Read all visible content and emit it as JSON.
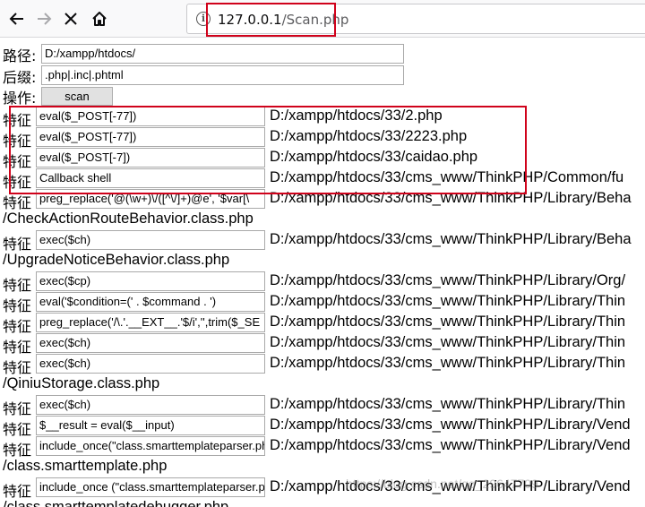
{
  "browser": {
    "back_icon": "arrow-left-icon",
    "forward_icon": "arrow-right-icon",
    "stop_icon": "close-icon",
    "home_icon": "home-icon",
    "info_icon": "info-icon",
    "url_host": "127.0.0.1",
    "url_path": "/Scan.php",
    "highlight_color": "#d0021b"
  },
  "form": {
    "path_label": "路径:",
    "path_value": "D:/xampp/htdocs/",
    "suffix_label": "后缀:",
    "suffix_value": ".php|.inc|.phtml",
    "action_label": "操作:",
    "scan_button": "scan"
  },
  "results": [
    {
      "label": "特征",
      "feature": "eval($_POST[-77])",
      "path": "D:/xampp/htdocs/33/2.php"
    },
    {
      "label": "特征",
      "feature": "eval($_POST[-77])",
      "path": "D:/xampp/htdocs/33/2223.php"
    },
    {
      "label": "特征",
      "feature": "eval($_POST[-7])",
      "path": "D:/xampp/htdocs/33/caidao.php"
    },
    {
      "label": "特征",
      "feature": "Callback shell",
      "path": "D:/xampp/htdocs/33/cms_www/ThinkPHP/Common/fu"
    },
    {
      "label": "特征",
      "feature": "preg_replace('@(\\w+)\\/([^\\/]+)@e', '$var[\\",
      "path": "D:/xampp/htdocs/33/cms_www/ThinkPHP/Library/Beha",
      "continuation": "/CheckActionRouteBehavior.class.php"
    },
    {
      "label": "特征",
      "feature": "exec($ch)",
      "path": "D:/xampp/htdocs/33/cms_www/ThinkPHP/Library/Beha",
      "continuation": "/UpgradeNoticeBehavior.class.php"
    },
    {
      "label": "特征",
      "feature": "exec($cp)",
      "path": "D:/xampp/htdocs/33/cms_www/ThinkPHP/Library/Org/"
    },
    {
      "label": "特征",
      "feature": "eval('$condition=(' . $command . ')",
      "path": "D:/xampp/htdocs/33/cms_www/ThinkPHP/Library/Thin"
    },
    {
      "label": "特征",
      "feature": "preg_replace('/\\.'.__EXT__.'$/i','',trim($_SE",
      "path": "D:/xampp/htdocs/33/cms_www/ThinkPHP/Library/Thin"
    },
    {
      "label": "特征",
      "feature": "exec($ch)",
      "path": "D:/xampp/htdocs/33/cms_www/ThinkPHP/Library/Thin"
    },
    {
      "label": "特征",
      "feature": "exec($ch)",
      "path": "D:/xampp/htdocs/33/cms_www/ThinkPHP/Library/Thin",
      "continuation": "/QiniuStorage.class.php"
    },
    {
      "label": "特征",
      "feature": "exec($ch)",
      "path": "D:/xampp/htdocs/33/cms_www/ThinkPHP/Library/Thin"
    },
    {
      "label": "特征",
      "feature": "$__result = eval($__input)",
      "path": "D:/xampp/htdocs/33/cms_www/ThinkPHP/Library/Vend"
    },
    {
      "label": "特征",
      "feature": "include_once(\"class.smarttemplateparser.ph",
      "path": "D:/xampp/htdocs/33/cms_www/ThinkPHP/Library/Vend",
      "continuation": "/class.smarttemplate.php"
    },
    {
      "label": "特征",
      "feature": "include_once (\"class.smarttemplateparser.p",
      "path": "D:/xampp/htdocs/33/cms_www/ThinkPHP/Library/Vend",
      "continuation": "/class.smarttemplatedebugger.php"
    }
  ],
  "watermark": "https://blog.csdn.net/qq_29647709"
}
